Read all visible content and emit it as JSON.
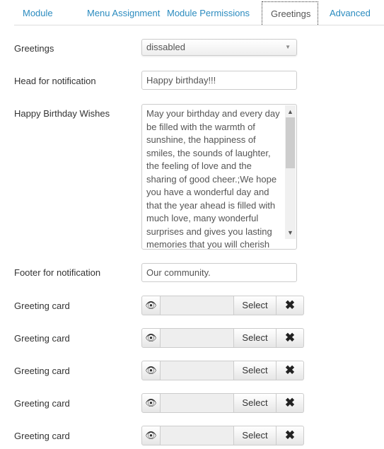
{
  "tabs": [
    "Module",
    "Menu Assignment",
    "Module Permissions",
    "Greetings",
    "Advanced"
  ],
  "active_tab": "Greetings",
  "form": {
    "greetings_label": "Greetings",
    "greetings_value": "dissabled",
    "head_label": "Head for notification",
    "head_value": "Happy birthday!!!",
    "wishes_label": "Happy Birthday Wishes",
    "wishes_value": "May your birthday and every day be filled with the warmth of sunshine, the happiness of smiles, the sounds of laughter, the feeling of love and the sharing of good cheer.;We hope you have a wonderful day and that the year ahead is filled with much love, many wonderful surprises and gives you lasting memories that you will cherish",
    "footer_label": "Footer for notification",
    "footer_value": "Our community.",
    "cards": [
      {
        "label": "Greeting card",
        "select": "Select",
        "value": ""
      },
      {
        "label": "Greeting card",
        "select": "Select",
        "value": ""
      },
      {
        "label": "Greeting card",
        "select": "Select",
        "value": ""
      },
      {
        "label": "Greeting card",
        "select": "Select",
        "value": ""
      },
      {
        "label": "Greeting card",
        "select": "Select",
        "value": ""
      }
    ]
  },
  "icons": {
    "preview": "eye-icon",
    "clear": "x-icon"
  },
  "colors": {
    "tab_link": "#2a8bbf"
  }
}
